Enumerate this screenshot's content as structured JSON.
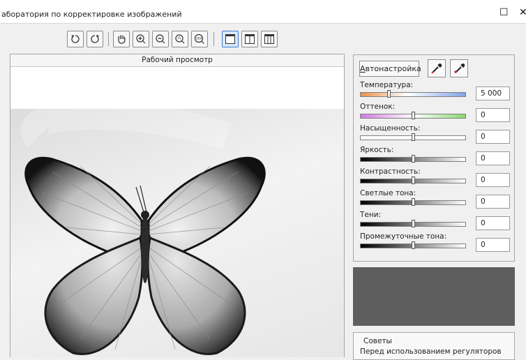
{
  "window": {
    "title": "аборатория по корректировке изображений",
    "maximize_glyph": "☐",
    "close_glyph": "✕"
  },
  "toolbar": {
    "buttons": [
      {
        "name": "rotate-left-icon"
      },
      {
        "name": "rotate-right-icon"
      },
      {
        "name": "hand-pan-icon"
      },
      {
        "name": "zoom-in-icon"
      },
      {
        "name": "zoom-out-icon"
      },
      {
        "name": "zoom-fit-icon"
      },
      {
        "name": "zoom-100-icon",
        "label": "100"
      },
      {
        "name": "single-view-icon",
        "active": true
      },
      {
        "name": "split-view-icon"
      },
      {
        "name": "side-by-side-view-icon"
      }
    ]
  },
  "preview": {
    "title": "Рабочий просмотр"
  },
  "panel": {
    "auto_button": "Автонастройка",
    "sliders": [
      {
        "label": "Температура:",
        "value": "5 000",
        "position": 0.27,
        "gradient": "linear-gradient(90deg,#e8904a,#ffffff 45%,#7ea4e8)"
      },
      {
        "label": "Оттенок:",
        "value": "0",
        "position": 0.5,
        "gradient": "linear-gradient(90deg,#d07be0,#ffffff 50%,#8ad870)"
      },
      {
        "label": "Насыщенность:",
        "value": "0",
        "position": 0.5,
        "gradient": "linear-gradient(90deg,#ffffff,#ffffff)"
      },
      {
        "label": "Яркость:",
        "value": "0",
        "position": 0.5,
        "gradient": "linear-gradient(90deg,#000000,#ffffff)"
      },
      {
        "label": "Контрастность:",
        "value": "0",
        "position": 0.5,
        "gradient": "linear-gradient(90deg,#000000,#ffffff)"
      },
      {
        "label": "Светлые тона:",
        "value": "0",
        "position": 0.5,
        "gradient": "linear-gradient(90deg,#000000,#ffffff)"
      },
      {
        "label": "Тени:",
        "value": "0",
        "position": 0.5,
        "gradient": "linear-gradient(90deg,#000000,#ffffff)"
      },
      {
        "label": "Промежуточные тона:",
        "value": "0",
        "position": 0.5,
        "gradient": "linear-gradient(90deg,#000000,#ffffff)"
      }
    ]
  },
  "tips": {
    "title": "Советы",
    "text": "Перед использованием регуляторов"
  },
  "colors": {
    "swatch": "#5e5e5e",
    "accent": "#3d7ad4"
  }
}
